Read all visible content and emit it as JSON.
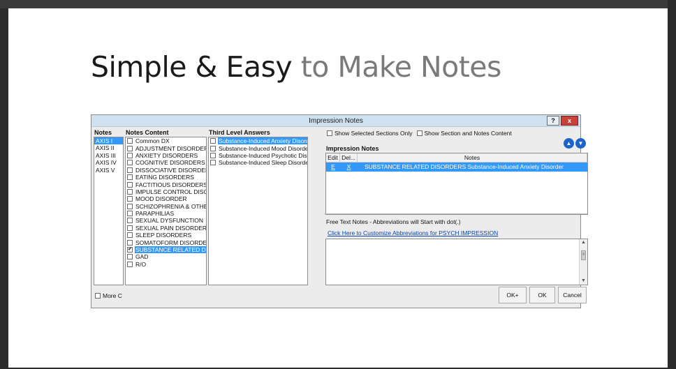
{
  "slide": {
    "title_dark": "Simple & Easy",
    "title_light": " to Make Notes"
  },
  "dialog": {
    "title": "Impression Notes",
    "help_label": "?",
    "close_label": "x",
    "notes": {
      "header": "Notes",
      "items": [
        "AXIS I",
        "AXIS II",
        "AXIS III",
        "AXIS IV",
        "AXIS V"
      ]
    },
    "notes_content": {
      "header": "Notes Content",
      "items": [
        {
          "label": "Common DX",
          "checked": false
        },
        {
          "label": "ADJUSTMENT DISORDERS",
          "checked": false
        },
        {
          "label": "ANXIETY DISORDERS",
          "checked": false
        },
        {
          "label": "COGNITIVE DISORDERS",
          "checked": false
        },
        {
          "label": "DISSOCIATIVE DISORDERS",
          "checked": false
        },
        {
          "label": "EATING DISORDERS",
          "checked": false
        },
        {
          "label": "FACTITIOUS DISORDERS",
          "checked": false
        },
        {
          "label": "IMPULSE CONTROL DISORI",
          "checked": false
        },
        {
          "label": "MOOD DISORDER",
          "checked": false
        },
        {
          "label": "SCHIZOPHRENIA & OTHER",
          "checked": false
        },
        {
          "label": "PARAPHILIAS",
          "checked": false
        },
        {
          "label": "SEXUAL DYSFUNCTION",
          "checked": false
        },
        {
          "label": "SEXUAL PAIN DISORDERS",
          "checked": false
        },
        {
          "label": "SLEEP DISORDERS",
          "checked": false
        },
        {
          "label": "SOMATOFORM DISORDERS",
          "checked": false
        },
        {
          "label": "SUBSTANCE RELATED DISC",
          "checked": true
        },
        {
          "label": "GAD",
          "checked": false
        },
        {
          "label": "R/O",
          "checked": false
        }
      ],
      "check_glyph": "✔"
    },
    "third_level": {
      "header": "Third Level Answers",
      "items": [
        {
          "label": "Substance-Induced Anxiety Disorder",
          "checked": false
        },
        {
          "label": "Substance-Induced Mood Disorder",
          "checked": false
        },
        {
          "label": "Substance-Induced Psychotic Disor",
          "checked": false
        },
        {
          "label": "Substance-Induced Sleep Disorder",
          "checked": false
        }
      ]
    },
    "options": {
      "show_selected": "Show Selected Sections Only",
      "show_section_notes": "Show Section and Notes Content"
    },
    "arrows": {
      "up": "▲",
      "down": "▼"
    },
    "impression_notes": {
      "header": "Impression Notes",
      "columns": [
        "Edit",
        "Del...",
        "Notes"
      ],
      "rows": [
        {
          "edit": "E",
          "del": "X",
          "notes": "SUBSTANCE RELATED DISORDERS Substance-Induced Anxiety Disorder"
        }
      ]
    },
    "free_text": {
      "label": "Free Text Notes - Abbreviations will Start with dot(.)",
      "link": "Click Here to Customize Abbreviations for PSYCH IMPRESSION",
      "value": ""
    },
    "more_checkbox": "More C",
    "buttons": {
      "ok_plus": "OK+",
      "ok": "OK",
      "cancel": "Cancel"
    }
  }
}
